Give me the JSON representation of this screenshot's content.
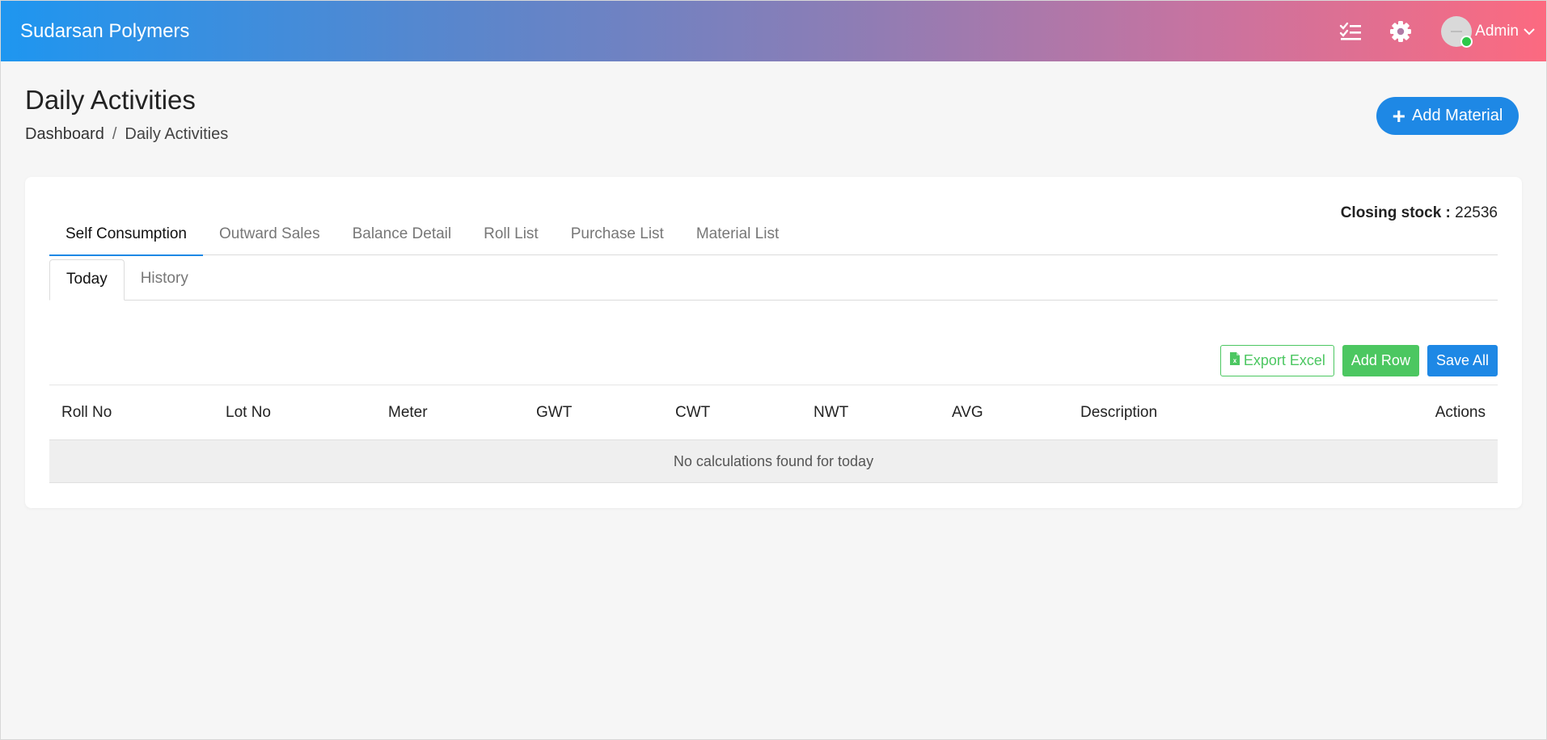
{
  "app": {
    "brand": "Sudarsan Polymers"
  },
  "user": {
    "name": "Admin"
  },
  "icons": {
    "tasks": "checklist-icon",
    "settings": "gear-icon",
    "user_menu": "chevron-down-icon",
    "add": "plus-icon",
    "excel": "excel-file-icon"
  },
  "header": {
    "title": "Daily Activities",
    "breadcrumb": [
      "Dashboard",
      "/",
      "Daily Activities"
    ],
    "add_material_label": "Add Material"
  },
  "tabs": {
    "items": [
      "Self Consumption",
      "Outward Sales",
      "Balance Detail",
      "Roll List",
      "Purchase List",
      "Material List"
    ],
    "active": "Self Consumption"
  },
  "closing_stock": {
    "label": "Closing stock :",
    "value": "22536"
  },
  "subtabs": {
    "items": [
      "Today",
      "History"
    ],
    "active": "Today"
  },
  "toolbar": {
    "export_label": "Export Excel",
    "add_row_label": "Add Row",
    "save_all_label": "Save All"
  },
  "table": {
    "columns": [
      "Roll No",
      "Lot No",
      "Meter",
      "GWT",
      "CWT",
      "NWT",
      "AVG",
      "Description",
      "Actions"
    ],
    "empty_message": "No calculations found for today"
  },
  "colors": {
    "primary": "#1e88e5",
    "success": "#4cc761",
    "gradient_start": "#1e96f0",
    "gradient_end": "#fc6a80"
  }
}
